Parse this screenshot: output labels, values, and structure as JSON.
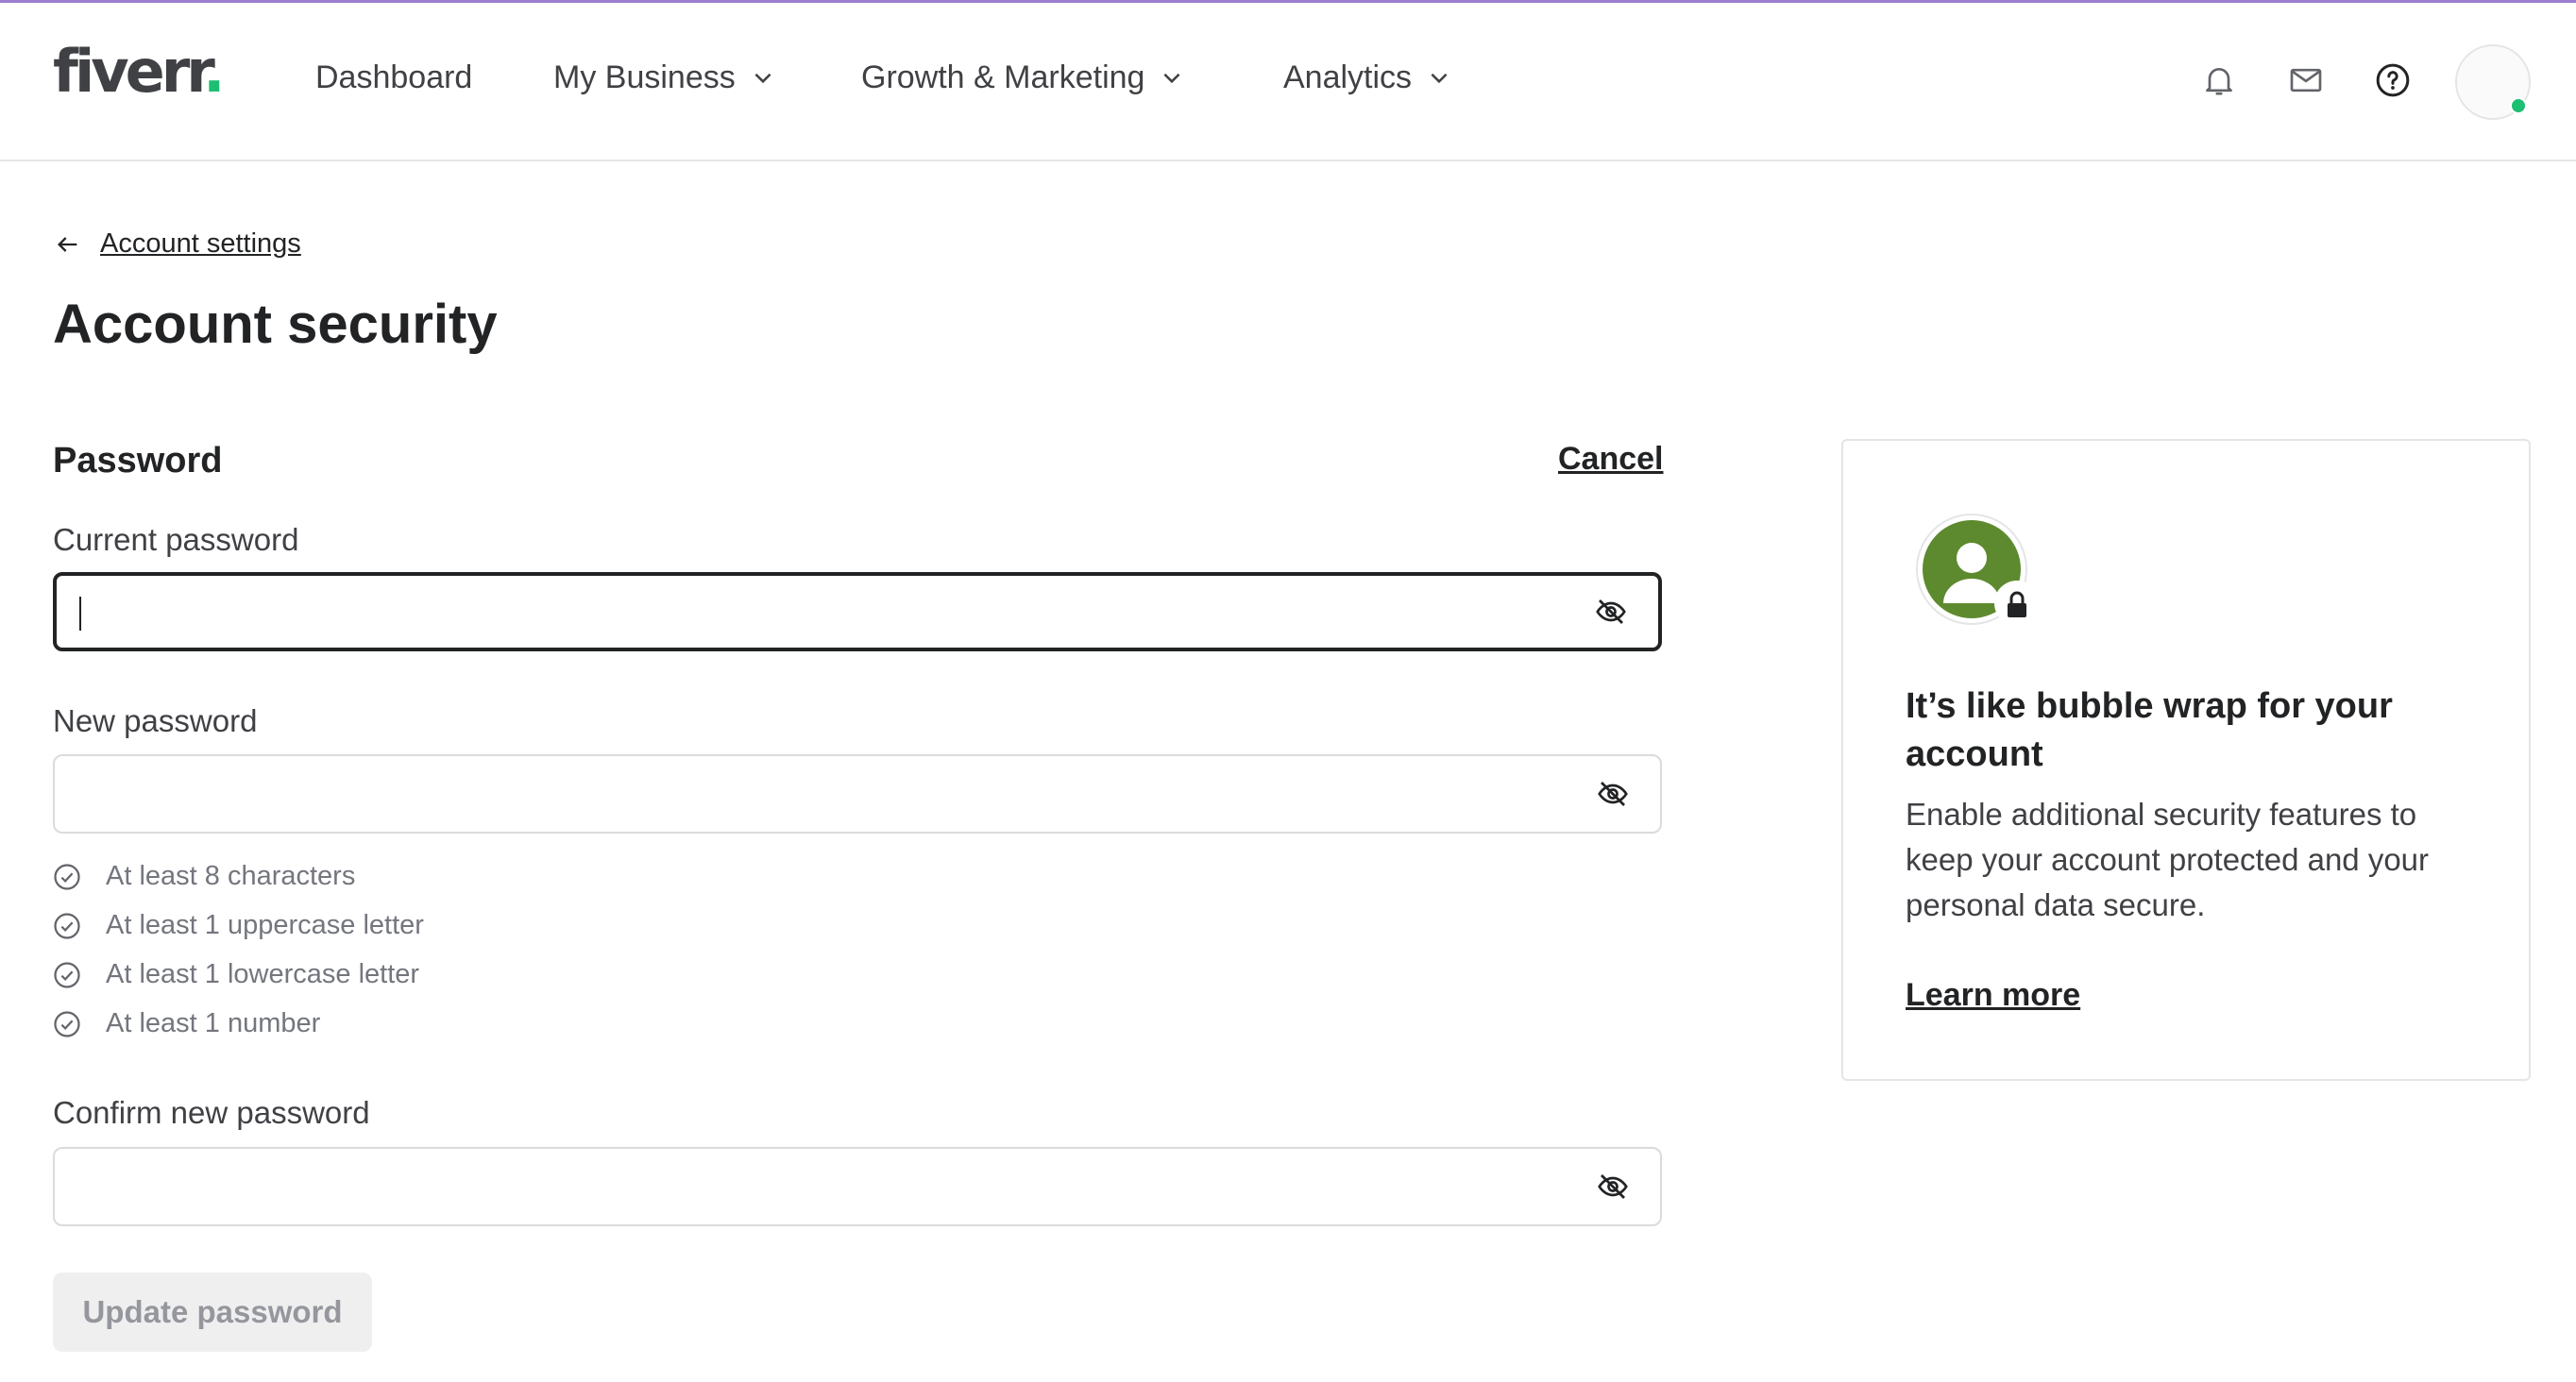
{
  "brand": {
    "logo_text": "fiverr",
    "logo_dot": ".",
    "accent_color": "#1dbf73"
  },
  "nav": {
    "items": [
      {
        "label": "Dashboard",
        "has_dropdown": false
      },
      {
        "label": "My Business",
        "has_dropdown": true
      },
      {
        "label": "Growth & Marketing",
        "has_dropdown": true
      },
      {
        "label": "Analytics",
        "has_dropdown": true
      }
    ],
    "icons": [
      "bell-icon",
      "mail-icon",
      "help-icon"
    ],
    "user_online": true
  },
  "breadcrumb": {
    "back_label": "Account settings"
  },
  "page": {
    "title": "Account security"
  },
  "password": {
    "section_title": "Password",
    "cancel_label": "Cancel",
    "current_label": "Current password",
    "current_value": "",
    "new_label": "New password",
    "new_value": "",
    "requirements": [
      "At least 8 characters",
      "At least 1 uppercase letter",
      "At least 1 lowercase letter",
      "At least 1 number"
    ],
    "confirm_label": "Confirm new password",
    "confirm_value": "",
    "submit_label": "Update password",
    "submit_disabled": true
  },
  "side_card": {
    "title": "It’s like bubble wrap for your account",
    "body": "Enable additional security features to keep your account protected and your personal data secure.",
    "link_label": "Learn more"
  }
}
